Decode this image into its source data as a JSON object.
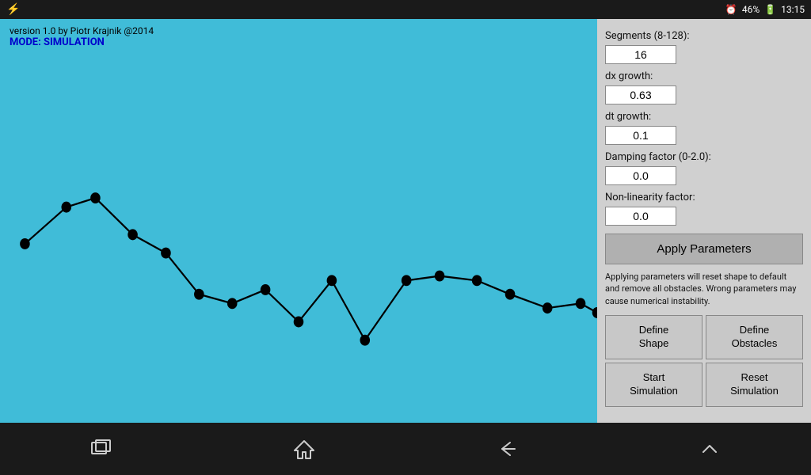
{
  "statusBar": {
    "battery": "46%",
    "time": "13:15"
  },
  "canvas": {
    "versionText": "version 1.0 by Piotr Krajnik @2014",
    "modeText": "MODE: SIMULATION"
  },
  "params": {
    "segmentsLabel": "Segments (8-128):",
    "segmentsValue": "16",
    "dxLabel": "dx growth:",
    "dxValue": "0.63",
    "dtLabel": "dt growth:",
    "dtValue": "0.1",
    "dampingLabel": "Damping factor (0-2.0):",
    "dampingValue": "0.0",
    "nonLinLabel": "Non-linearity factor:",
    "nonLinValue": "0.0",
    "applyBtn": "Apply Parameters",
    "warningText": "Applying parameters will reset shape to default and remove all obstacles. Wrong parameters may cause numerical instability."
  },
  "buttons": {
    "defineShape": "Define\nShape",
    "defineObstacles": "Define\nObstacles",
    "startSimulation": "Start\nSimulation",
    "resetSimulation": "Reset\nSimulation"
  },
  "navIcons": {
    "square": "⬜",
    "home": "⌂",
    "back": "↩",
    "up": "⌃"
  }
}
